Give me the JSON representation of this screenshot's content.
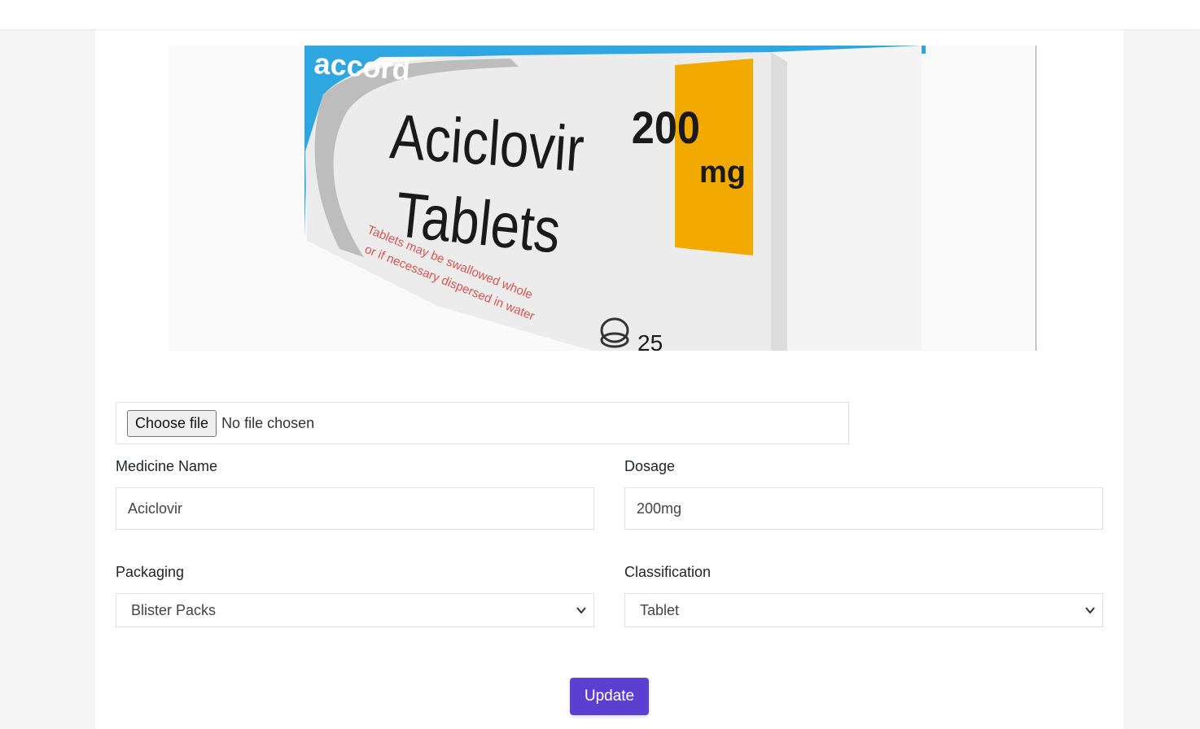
{
  "product_image": {
    "alt": "Aciclovir Tablets box",
    "brand": "accord",
    "box_title_line1": "Aciclovir",
    "box_title_line2": "Tablets",
    "strength_number": "200",
    "strength_unit": "mg",
    "instructions_line1": "Tablets may be swallowed whole",
    "instructions_line2": "or if necessary dispersed in water",
    "count_partial": "25",
    "colors": {
      "box_blue": "#2ea6e0",
      "badge_orange": "#f2a900",
      "text_dark": "#1a1a1a",
      "text_red": "#d9534f"
    }
  },
  "file_upload": {
    "button_label": "Choose file",
    "status_text": "No file chosen"
  },
  "form": {
    "medicine_name": {
      "label": "Medicine Name",
      "value": "Aciclovir"
    },
    "dosage": {
      "label": "Dosage",
      "value": "200mg"
    },
    "packaging": {
      "label": "Packaging",
      "selected": "Blister Packs"
    },
    "classification": {
      "label": "Classification",
      "selected": "Tablet"
    }
  },
  "actions": {
    "update_label": "Update"
  },
  "theme": {
    "primary": "#5b3fd1",
    "page_bg": "#f5f5f5",
    "border": "#dee2e6"
  }
}
